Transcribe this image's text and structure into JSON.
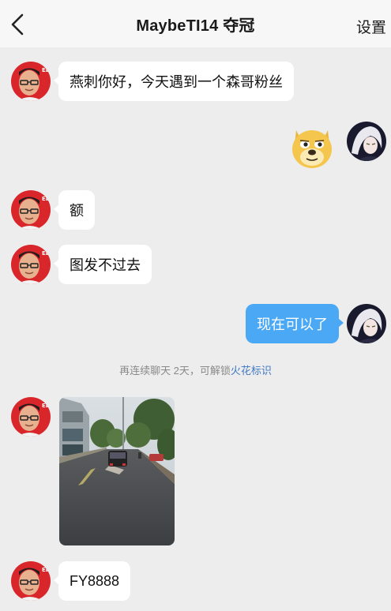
{
  "header": {
    "title": "MaybeTI14 夺冠",
    "settings_label": "设置",
    "back_icon": "chevron-left-icon"
  },
  "messages": [
    {
      "side": "left",
      "type": "text",
      "text": "燕刺你好，今天遇到一个森哥粉丝"
    },
    {
      "side": "right",
      "type": "sticker",
      "sticker": "doge-emoji"
    },
    {
      "side": "left",
      "type": "text",
      "text": "额"
    },
    {
      "side": "left",
      "type": "text",
      "text": "图发不过去"
    },
    {
      "side": "right",
      "type": "text",
      "text": "现在可以了"
    },
    {
      "side": "left",
      "type": "image",
      "image": "street-photo"
    },
    {
      "side": "left",
      "type": "text",
      "text": "FY8888"
    }
  ],
  "system_note": {
    "prefix": "再连续聊天 2天，可解锁",
    "link": "火花标识"
  },
  "colors": {
    "background": "#ededed",
    "header": "#f7f7f7",
    "outgoing_bubble": "#4aa8f5",
    "incoming_bubble": "#ffffff",
    "link": "#3f78c4",
    "avatar_red": "#d8262a"
  }
}
